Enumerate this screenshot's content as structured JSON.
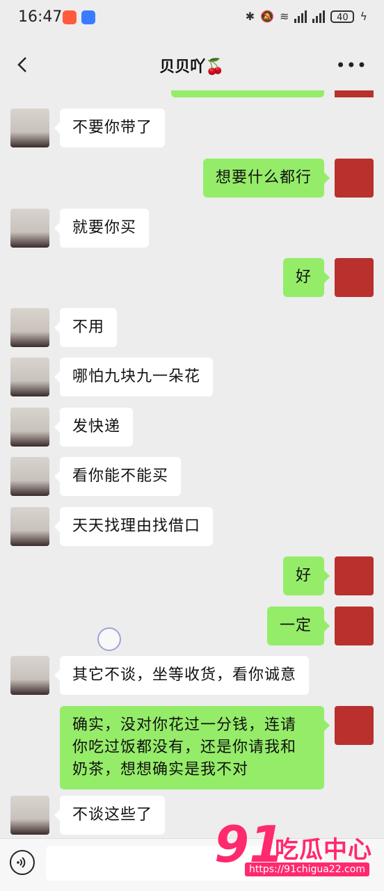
{
  "status_bar": {
    "time": "16:47",
    "battery": "40"
  },
  "header": {
    "title": "贝贝吖🍒"
  },
  "messages": [
    {
      "from": "her",
      "text": "不要你带了"
    },
    {
      "from": "me",
      "text": "想要什么都行"
    },
    {
      "from": "her",
      "text": "就要你买"
    },
    {
      "from": "me",
      "text": "好"
    },
    {
      "from": "her",
      "text": "不用"
    },
    {
      "from": "her",
      "text": "哪怕九块九一朵花"
    },
    {
      "from": "her",
      "text": "发快递"
    },
    {
      "from": "her",
      "text": "看你能不能买"
    },
    {
      "from": "her",
      "text": "天天找理由找借口"
    },
    {
      "from": "me",
      "text": "好"
    },
    {
      "from": "me",
      "text": "一定"
    },
    {
      "from": "her",
      "text": "其它不谈，坐等收货，看你诚意"
    },
    {
      "from": "me",
      "text": "确实，没对你花过一分钱，连请你吃过饭都没有，还是你请我和奶茶，想想确实是我不对"
    },
    {
      "from": "her",
      "text": "不谈这些了"
    }
  ],
  "watermark": {
    "brand_num": "91",
    "brand_cn": "吃瓜中心",
    "url": "https://91chigua22.com"
  },
  "colors": {
    "my_bubble": "#95ec69",
    "her_bubble": "#ffffff",
    "background": "#ededed",
    "watermark": "#ff2a6d"
  }
}
